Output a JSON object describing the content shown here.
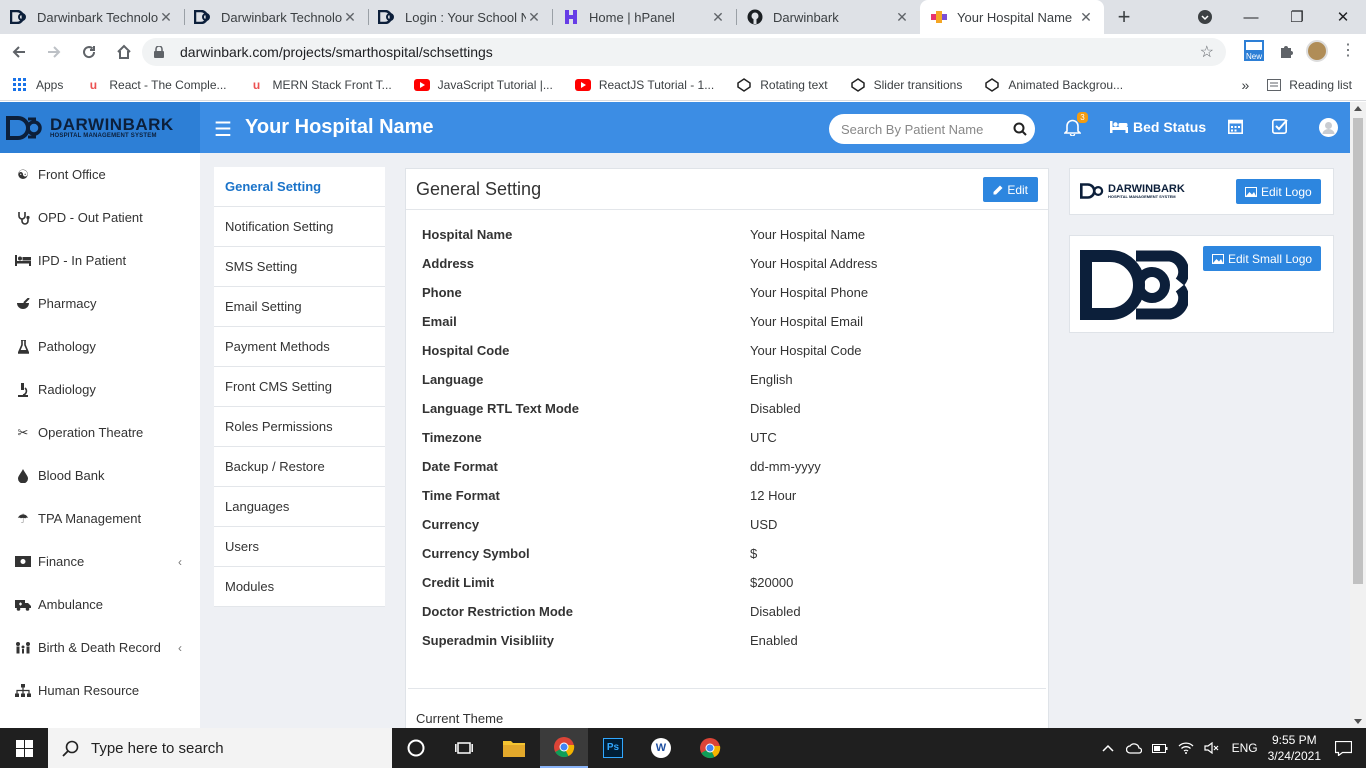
{
  "browser": {
    "tabs": [
      {
        "label": "Darwinbark Technolog",
        "icon": "db-logo-icon"
      },
      {
        "label": "Darwinbark Technolog",
        "icon": "db-logo-icon"
      },
      {
        "label": "Login : Your School Na",
        "icon": "db-logo-icon"
      },
      {
        "label": "Home | hPanel",
        "icon": "hpanel-icon"
      },
      {
        "label": "Darwinbark",
        "icon": "github-icon"
      },
      {
        "label": "Your Hospital Name",
        "icon": "hospital-favicon-icon"
      }
    ],
    "url": "darwinbark.com/projects/smarthospital/schsettings",
    "new_badge": "New",
    "bookmarks": [
      {
        "label": "Apps"
      },
      {
        "label": "React - The Comple..."
      },
      {
        "label": "MERN Stack Front T..."
      },
      {
        "label": "JavaScript Tutorial |..."
      },
      {
        "label": "ReactJS Tutorial - 1..."
      },
      {
        "label": "Rotating text"
      },
      {
        "label": "Slider transitions"
      },
      {
        "label": "Animated Backgrou..."
      }
    ],
    "more_bookmarks": "»",
    "reading_list": "Reading list"
  },
  "header": {
    "brand_name": "DARWINBARK",
    "brand_sub": "HOSPITAL MANAGEMENT SYSTEM",
    "hospital_name": "Your Hospital Name",
    "search_placeholder": "Search By Patient Name",
    "notification_count": "3",
    "bed_status": "Bed Status"
  },
  "sidebar": {
    "items": [
      {
        "label": "Front Office",
        "icon": "front-office-icon"
      },
      {
        "label": "OPD - Out Patient",
        "icon": "stethoscope-icon"
      },
      {
        "label": "IPD - In Patient",
        "icon": "bed-icon"
      },
      {
        "label": "Pharmacy",
        "icon": "mortar-pestle-icon"
      },
      {
        "label": "Pathology",
        "icon": "flask-icon"
      },
      {
        "label": "Radiology",
        "icon": "microscope-icon"
      },
      {
        "label": "Operation Theatre",
        "icon": "scissors-icon"
      },
      {
        "label": "Blood Bank",
        "icon": "drop-icon"
      },
      {
        "label": "TPA Management",
        "icon": "umbrella-icon"
      },
      {
        "label": "Finance",
        "icon": "money-icon",
        "chevron": "‹"
      },
      {
        "label": "Ambulance",
        "icon": "ambulance-icon"
      },
      {
        "label": "Birth & Death Record",
        "icon": "family-icon",
        "chevron": "‹"
      },
      {
        "label": "Human Resource",
        "icon": "sitemap-icon"
      }
    ]
  },
  "settings_menu": {
    "items": [
      {
        "label": "General Setting"
      },
      {
        "label": "Notification Setting"
      },
      {
        "label": "SMS Setting"
      },
      {
        "label": "Email Setting"
      },
      {
        "label": "Payment Methods"
      },
      {
        "label": "Front CMS Setting"
      },
      {
        "label": "Roles Permissions"
      },
      {
        "label": "Backup / Restore"
      },
      {
        "label": "Languages"
      },
      {
        "label": "Users"
      },
      {
        "label": "Modules"
      }
    ]
  },
  "general": {
    "title": "General Setting",
    "edit_label": "Edit",
    "rows": [
      {
        "label": "Hospital Name",
        "value": "Your Hospital Name"
      },
      {
        "label": "Address",
        "value": "Your Hospital Address"
      },
      {
        "label": "Phone",
        "value": "Your Hospital Phone"
      },
      {
        "label": "Email",
        "value": "Your Hospital Email"
      },
      {
        "label": "Hospital Code",
        "value": "Your Hospital Code"
      },
      {
        "label": "Language",
        "value": "English"
      },
      {
        "label": "Language RTL Text Mode",
        "value": "Disabled"
      },
      {
        "label": "Timezone",
        "value": "UTC"
      },
      {
        "label": "Date Format",
        "value": "dd-mm-yyyy"
      },
      {
        "label": "Time Format",
        "value": "12 Hour"
      },
      {
        "label": "Currency",
        "value": "USD"
      },
      {
        "label": "Currency Symbol",
        "value": "$"
      },
      {
        "label": "Credit Limit",
        "value": "$20000"
      },
      {
        "label": "Doctor Restriction Mode",
        "value": "Disabled"
      },
      {
        "label": "Superadmin Visibliity",
        "value": "Enabled"
      }
    ],
    "current_theme": "Current Theme"
  },
  "logos": {
    "edit_logo": "Edit Logo",
    "edit_small_logo": "Edit Small Logo"
  },
  "taskbar": {
    "search_placeholder": "Type here to search",
    "lang": "ENG",
    "time": "9:55 PM",
    "date": "3/24/2021"
  },
  "colors": {
    "header_blue": "#3c8de4",
    "button_blue": "#2d86df",
    "navy": "#0c1f3a"
  }
}
